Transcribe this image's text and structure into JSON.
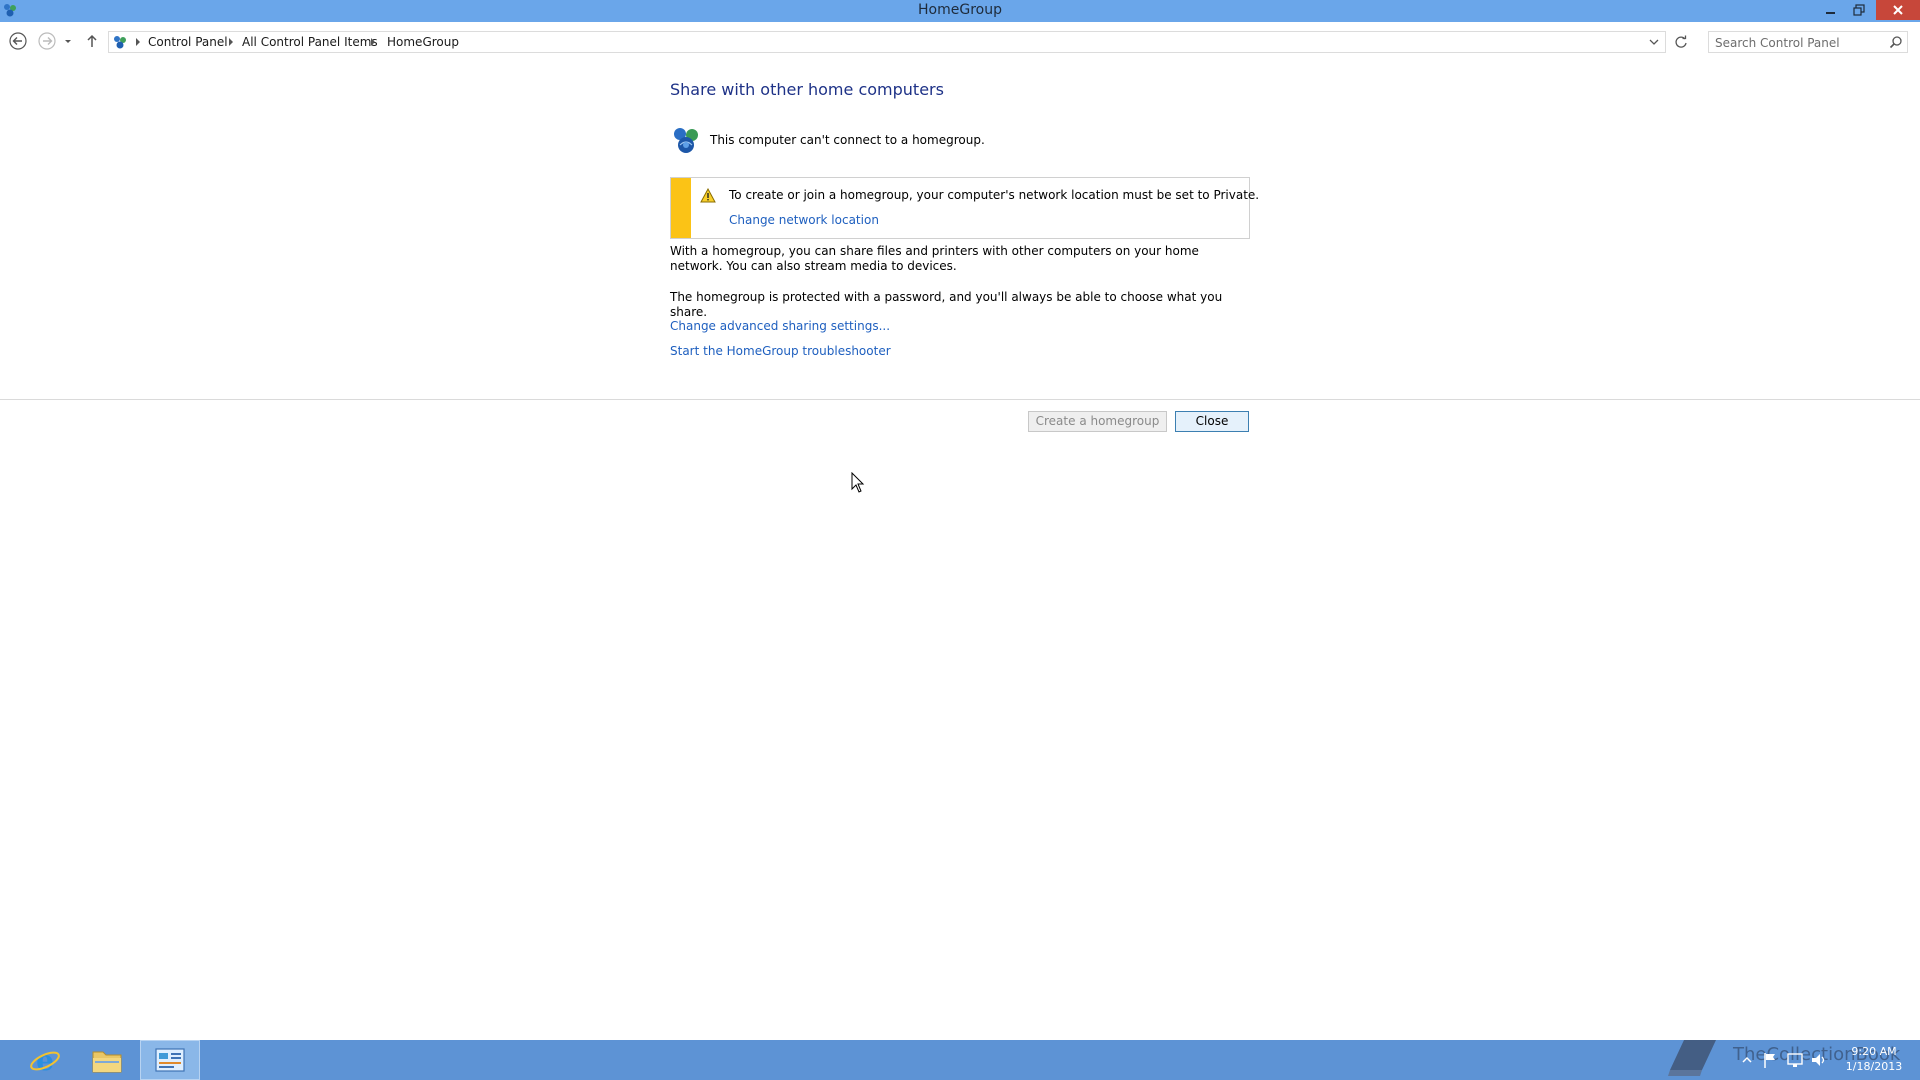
{
  "window": {
    "title": "HomeGroup"
  },
  "address": {
    "crumbs": [
      "Control Panel",
      "All Control Panel Items",
      "HomeGroup"
    ],
    "search_placeholder": "Search Control Panel"
  },
  "content": {
    "title": "Share with other home computers",
    "status": "This computer can't connect to a homegroup.",
    "warning_text": "To create or join a homegroup, your computer's network location must be set to Private.",
    "warning_link": "Change network location",
    "paragraph1": "With a homegroup, you can share files and printers with other computers on your home network. You can also stream media to devices.",
    "paragraph2": "The homegroup is protected with a password, and you'll always be able to choose what you share.",
    "link_advanced": "Change advanced sharing settings...",
    "link_troubleshooter": "Start the HomeGroup troubleshooter"
  },
  "buttons": {
    "create": "Create a homegroup",
    "close": "Close"
  },
  "taskbar": {
    "watermark": "TheCollectionBook",
    "time": "9:20 AM",
    "date": "1/18/2013"
  },
  "colors": {
    "titlebar": "#6aa6ea",
    "taskbar": "#5d93d5",
    "link": "#1e5fbf",
    "heading": "#1e3287",
    "warning_stripe": "#fbc316",
    "close_button": "#c7473a"
  }
}
